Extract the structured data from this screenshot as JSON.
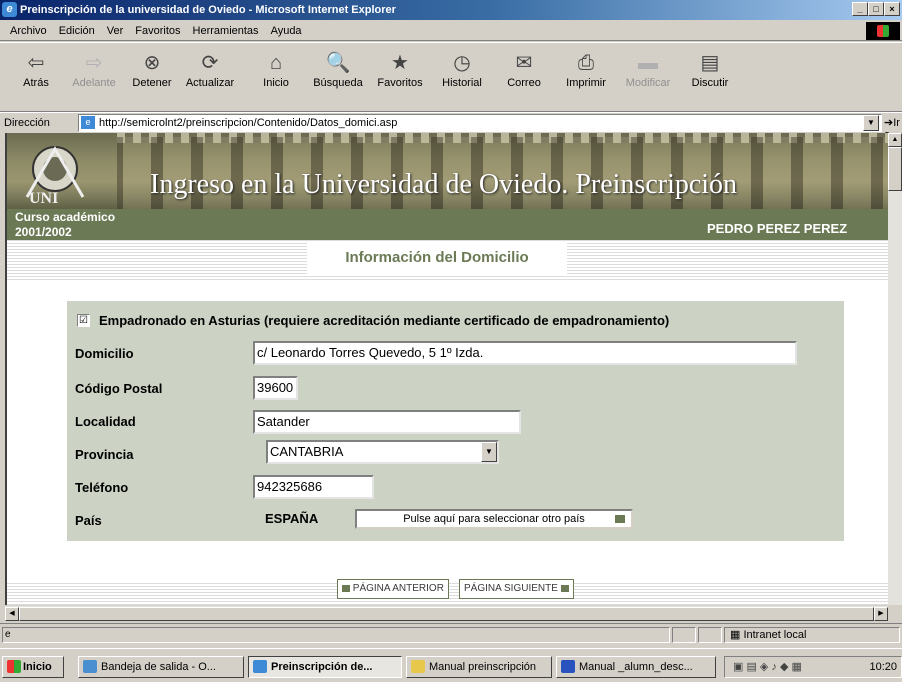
{
  "window": {
    "title": "Preinscripción de la universidad de Oviedo - Microsoft Internet Explorer"
  },
  "menu": [
    "Archivo",
    "Edición",
    "Ver",
    "Favoritos",
    "Herramientas",
    "Ayuda"
  ],
  "toolbar": [
    {
      "label": "Atrás",
      "icon": "back-arrow-icon",
      "glyph": "⇦"
    },
    {
      "label": "Adelante",
      "icon": "forward-arrow-icon",
      "glyph": "⇨",
      "disabled": true
    },
    {
      "label": "Detener",
      "icon": "stop-icon",
      "glyph": "⊗"
    },
    {
      "label": "Actualizar",
      "icon": "refresh-icon",
      "glyph": "⟳"
    },
    {
      "label": "Inicio",
      "icon": "home-icon",
      "glyph": "⌂"
    },
    {
      "label": "Búsqueda",
      "icon": "search-icon",
      "glyph": "🔍"
    },
    {
      "label": "Favoritos",
      "icon": "favorites-icon",
      "glyph": "★"
    },
    {
      "label": "Historial",
      "icon": "history-icon",
      "glyph": "◷"
    },
    {
      "label": "Correo",
      "icon": "mail-icon",
      "glyph": "✉"
    },
    {
      "label": "Imprimir",
      "icon": "print-icon",
      "glyph": "⎙"
    },
    {
      "label": "Modificar",
      "icon": "edit-icon",
      "glyph": "▬",
      "disabled": true
    },
    {
      "label": "Discutir",
      "icon": "discuss-icon",
      "glyph": "▤"
    }
  ],
  "address": {
    "label": "Dirección",
    "url": "http://semicrolnt2/preinscripcion/Contenido/Datos_domici.asp",
    "go": "Ir a"
  },
  "page": {
    "banner_title": "Ingreso en la Universidad de Oviedo. Preinscripción",
    "course_label": "Curso académico",
    "course_year": "2001/2002",
    "user_name": "PEDRO PEREZ PEREZ",
    "section_title": "Información del Domicilio",
    "empadronado_label": "Empadronado en Asturias (requiere acreditación mediante certificado de empadronamiento)",
    "empadronado_checked": "☑",
    "fields": {
      "domicilio_label": "Domicilio",
      "domicilio_value": "c/ Leonardo Torres Quevedo, 5 1º Izda.",
      "cp_label": "Código Postal",
      "cp_value": "39600",
      "localidad_label": "Localidad",
      "localidad_value": "Satander",
      "provincia_label": "Provincia",
      "provincia_value": "CANTABRIA",
      "telefono_label": "Teléfono",
      "telefono_value": "942325686",
      "pais_label": "País",
      "pais_value": "ESPAÑA",
      "pais_button": "Pulse aquí para seleccionar otro país"
    },
    "nav": {
      "prev": "PÁGINA ANTERIOR",
      "next": "PÁGINA SIGUIENTE"
    }
  },
  "status": {
    "zone": "Intranet local"
  },
  "taskbar": {
    "start": "Inicio",
    "tasks": [
      "Bandeja de salida - O...",
      "Preinscripción de...",
      "Manual preinscripción",
      "Manual _alumn_desc..."
    ],
    "clock": "10:20"
  },
  "colors": {
    "accent_green": "#6b7a55",
    "panel": "#ccd2c4",
    "title_bar": "#0a246a"
  }
}
